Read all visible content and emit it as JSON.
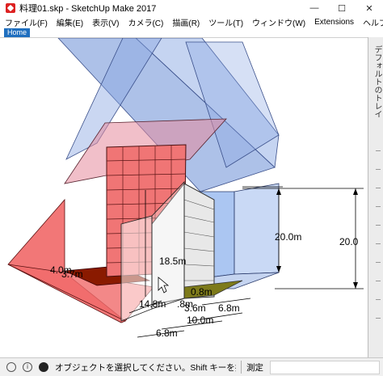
{
  "window": {
    "title": "料理01.skp - SketchUp Make 2017",
    "minimize": "—",
    "maximize": "☐",
    "close": "✕"
  },
  "menu": [
    "ファイル(F)",
    "編集(E)",
    "表示(V)",
    "カメラ(C)",
    "描画(R)",
    "ツール(T)",
    "ウィンドウ(W)",
    "Extensions",
    "ヘルプ(H)"
  ],
  "tab": {
    "home": "Home"
  },
  "tray": {
    "label": "デフォルトのトレイ"
  },
  "dimensions": {
    "left_a": "4.0m",
    "left_b": "3.7m",
    "height_mid": "18.5m",
    "depth_front": "14.8m",
    "small_a": ".8m",
    "small_b": "0.8m",
    "width_a": "3.6m",
    "width_b": "6.8m",
    "width_c": "10.0m",
    "width_d": "6.8m",
    "right_height_m": "20.0m",
    "right_height": "20.0"
  },
  "status": {
    "message": "オブジェクトを選択してください。Shift キーを押したまま...",
    "measure_label": "測定",
    "measure_value": ""
  },
  "icons": {
    "info": "i",
    "geo": "globe-icon",
    "user": "user-icon"
  }
}
